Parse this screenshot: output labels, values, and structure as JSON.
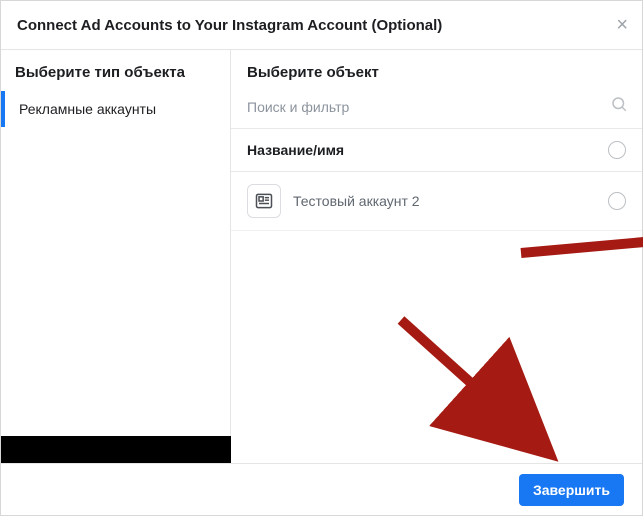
{
  "header": {
    "title": "Connect Ad Accounts to Your Instagram Account (Optional)"
  },
  "sidebar": {
    "heading": "Выберите тип объекта",
    "items": [
      {
        "label": "Рекламные аккаунты",
        "selected": true
      }
    ]
  },
  "main": {
    "heading": "Выберите объект",
    "search_placeholder": "Поиск и фильтр",
    "column_header": "Название/имя",
    "rows": [
      {
        "label": "Тестовый аккаунт 2"
      }
    ]
  },
  "footer": {
    "submit_label": "Завершить"
  }
}
